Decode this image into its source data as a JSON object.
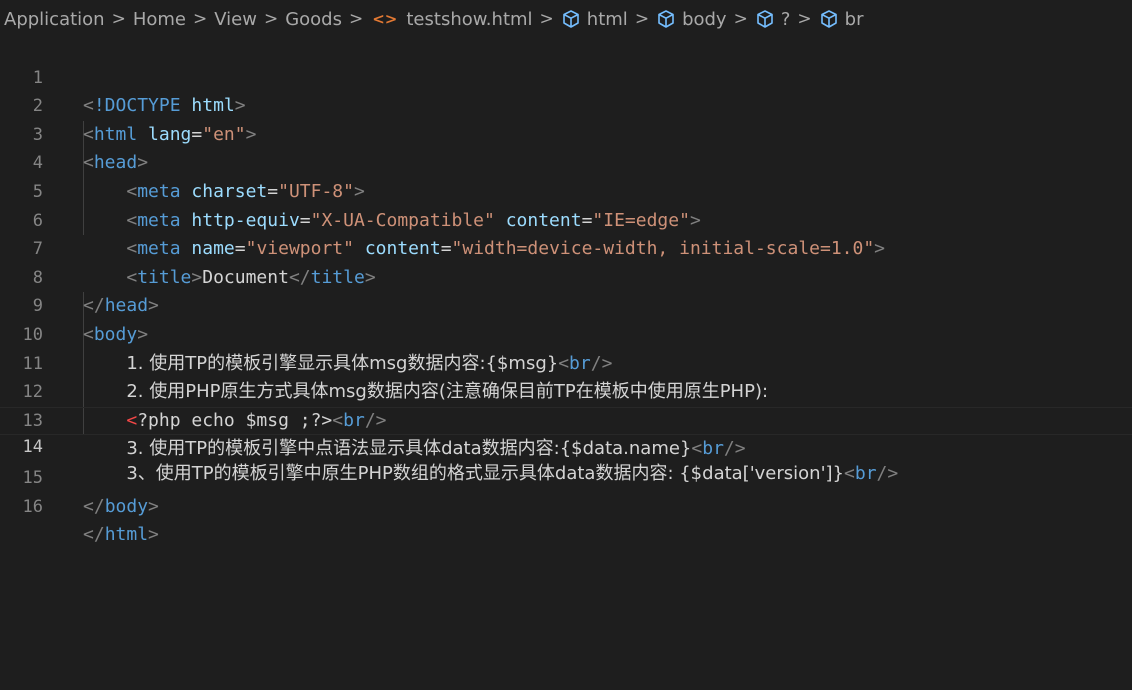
{
  "breadcrumb": {
    "items": [
      "Application",
      "Home",
      "View",
      "Goods"
    ],
    "file": "testshow.html",
    "symbols": [
      "html",
      "body",
      "?",
      "br"
    ],
    "separator": ">",
    "file_icon": "<>"
  },
  "editor": {
    "current_line": 14,
    "line_numbers": [
      "1",
      "2",
      "3",
      "4",
      "5",
      "6",
      "7",
      "8",
      "9",
      "10",
      "11",
      "12",
      "13",
      "14",
      "15",
      "16"
    ],
    "lines": {
      "l1": {
        "lt": "<",
        "doctype": "!DOCTYPE",
        "space": " ",
        "name": "html",
        "gt": ">"
      },
      "l2": {
        "lt": "<",
        "tag": "html",
        "space": " ",
        "attr": "lang",
        "eq": "=",
        "val": "\"en\"",
        "gt": ">"
      },
      "l3": {
        "lt": "<",
        "tag": "head",
        "gt": ">"
      },
      "l4": {
        "indent": "    ",
        "lt": "<",
        "tag": "meta",
        "space": " ",
        "attr": "charset",
        "eq": "=",
        "val": "\"UTF-8\"",
        "gt": ">"
      },
      "l5": {
        "indent": "    ",
        "lt": "<",
        "tag": "meta",
        "space": " ",
        "attr1": "http-equiv",
        "eq1": "=",
        "val1": "\"X-UA-Compatible\"",
        "space2": " ",
        "attr2": "content",
        "eq2": "=",
        "val2": "\"IE=edge\"",
        "gt": ">"
      },
      "l6": {
        "indent": "    ",
        "lt": "<",
        "tag": "meta",
        "space": " ",
        "attr1": "name",
        "eq1": "=",
        "val1": "\"viewport\"",
        "space2": " ",
        "attr2": "content",
        "eq2": "=",
        "val2": "\"width=device-width, initial-scale=1.0\"",
        "gt": ">"
      },
      "l7": {
        "indent": "    ",
        "lt": "<",
        "tag": "title",
        "gt": ">",
        "text": "Document",
        "lt2": "</",
        "tag2": "title",
        "gt2": ">"
      },
      "l8": {
        "lt": "</",
        "tag": "head",
        "gt": ">"
      },
      "l9": {
        "lt": "<",
        "tag": "body",
        "gt": ">"
      },
      "l10": {
        "indent": "    ",
        "text": "1. 使用TP的模板引擎显示具体msg数据内容:{$msg}",
        "lt": "<",
        "tag": "br",
        "gt": "/>"
      },
      "l11": {
        "indent": "    ",
        "text": "2. 使用PHP原生方式具体msg数据内容(注意确保目前TP在模板中使用原生PHP):"
      },
      "l12": {
        "indent": "    ",
        "php_open": "<",
        "text": "?php echo $msg ;?>",
        "lt": "<",
        "tag": "br",
        "gt": "/>"
      },
      "l13": {
        "indent": "    ",
        "text": "3. 使用TP的模板引擎中点语法显示具体data数据内容:{$data.name}",
        "lt": "<",
        "tag": "br",
        "gt": "/>"
      },
      "l14": {
        "indent": "    ",
        "text": "3、使用TP的模板引擎中原生PHP数组的格式显示具体data数据内容: {$data['version']}",
        "lt": "<",
        "tag": "br",
        "gt": "/>"
      },
      "l15": {
        "lt": "</",
        "tag": "body",
        "gt": ">"
      },
      "l16": {
        "lt": "</",
        "tag": "html",
        "gt": ">"
      }
    }
  },
  "colors": {
    "background": "#1e1e1e",
    "tag": "#569cd6",
    "attribute": "#9cdcfe",
    "string": "#ce9178",
    "bracket": "#808080",
    "text": "#d4d4d4",
    "line_number": "#858585",
    "file_icon": "#e37933"
  },
  "icons": {
    "file": "html-file-icon",
    "symbol": "cube-icon"
  }
}
